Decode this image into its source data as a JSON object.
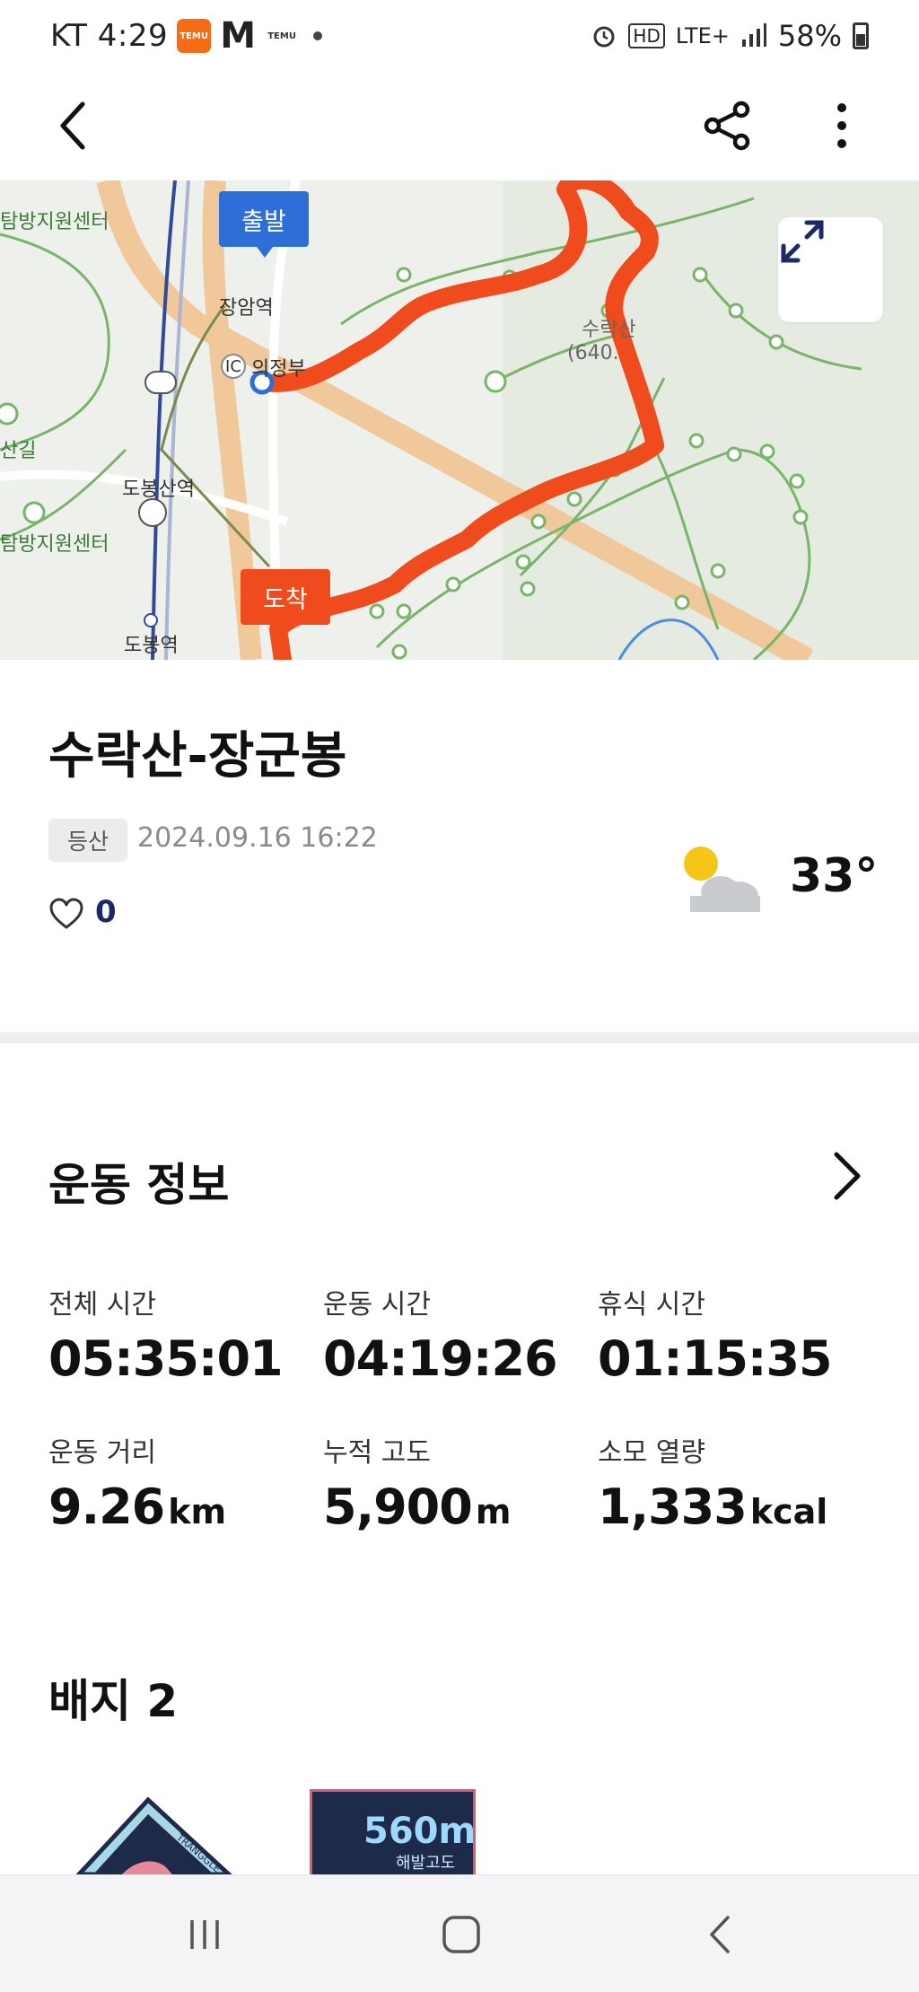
{
  "status_bar": {
    "carrier_time": "KT 4:29",
    "app_badge_temu": "TEMU",
    "app_badge_m": "M",
    "app_badge_temu2": "TEMU",
    "network": "LTE+",
    "hd": "HD",
    "battery": "58%"
  },
  "map": {
    "labels": {
      "label_1": "탐방지원센터",
      "label_2": "장암역",
      "label_3": "의정부",
      "label_4": "산길",
      "label_5": "도봉산역",
      "label_6": "탐방지원센터",
      "label_7": "도봉역",
      "label_8": "수락산",
      "label_9": "(640.",
      "ic": "IC"
    },
    "start_marker": "출발",
    "end_marker": "도착",
    "route_color": "#f04b1c"
  },
  "activity": {
    "title": "수락산-장군봉",
    "tag": "등산",
    "date": "2024.09.16 16:22",
    "like_count": "0",
    "temperature": "33°",
    "weather_icon": "partly-cloudy-icon"
  },
  "exercise": {
    "section_title": "운동 정보",
    "stats": [
      {
        "label": "전체 시간",
        "value": "05:35:01",
        "unit": ""
      },
      {
        "label": "운동 시간",
        "value": "04:19:26",
        "unit": ""
      },
      {
        "label": "휴식 시간",
        "value": "01:15:35",
        "unit": ""
      },
      {
        "label": "운동 거리",
        "value": "9.26",
        "unit": "km"
      },
      {
        "label": "누적 고도",
        "value": "5,900",
        "unit": "m"
      },
      {
        "label": "소모 열량",
        "value": "1,333",
        "unit": "kcal"
      }
    ]
  },
  "badges": {
    "title": "배지 2",
    "badge_1_text": "TRANGGLE",
    "badge_2_value": "560m",
    "badge_2_label": "해발고도"
  },
  "colors": {
    "accent_blue": "#2d6fd6",
    "route_red": "#f04b1c",
    "like_count": "#1a2a66"
  }
}
